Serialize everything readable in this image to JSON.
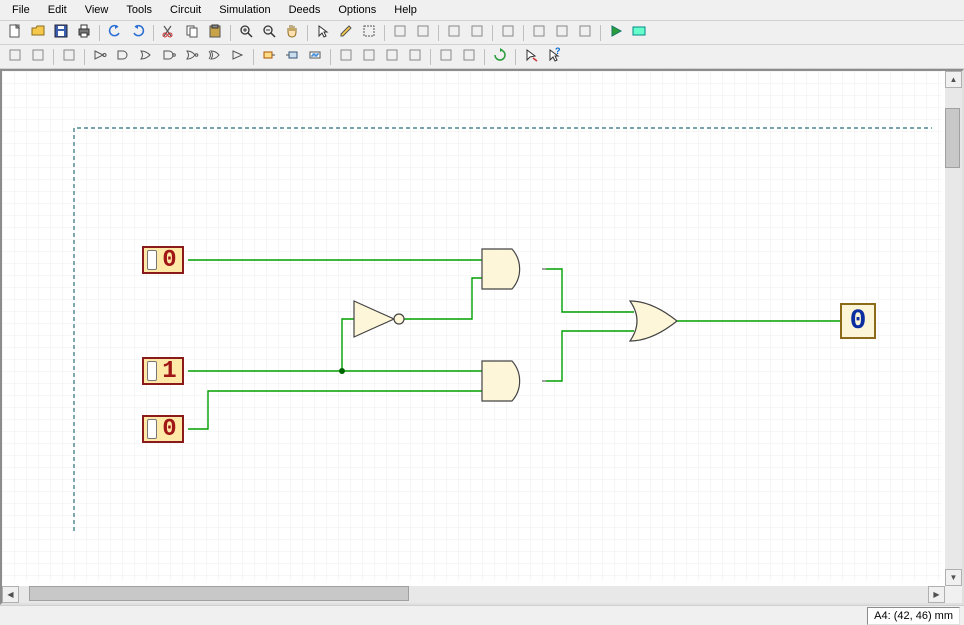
{
  "menu": [
    "File",
    "Edit",
    "View",
    "Tools",
    "Circuit",
    "Simulation",
    "Deeds",
    "Options",
    "Help"
  ],
  "status": {
    "coords": "A4: (42, 46) mm"
  },
  "toolbar1": [
    "new",
    "open",
    "save",
    "print",
    "sep",
    "undo",
    "redo",
    "sep",
    "cut",
    "copy",
    "paste",
    "sep",
    "zoom-in",
    "zoom-out",
    "pan",
    "sep",
    "pointer",
    "pencil",
    "select-rect",
    "sep",
    "component1",
    "component2",
    "sep",
    "mode1",
    "mode2",
    "sep",
    "grid",
    "sep",
    "wave1",
    "wave2",
    "wave3",
    "sep",
    "play",
    "animate"
  ],
  "toolbar2": [
    "ic1",
    "ic2",
    "sep",
    "probe",
    "sep",
    "not",
    "and",
    "or",
    "nand",
    "nor",
    "xor",
    "buffer",
    "sep",
    "input",
    "output",
    "clock",
    "sep",
    "display",
    "led",
    "segment",
    "bus",
    "sep",
    "mux",
    "demux",
    "sep",
    "refresh",
    "sep",
    "cursor",
    "help"
  ],
  "circuit": {
    "inputs": [
      {
        "id": "in0",
        "value": "0"
      },
      {
        "id": "in1",
        "value": "1"
      },
      {
        "id": "in2",
        "value": "0"
      }
    ],
    "output": {
      "id": "out0",
      "value": "0"
    },
    "gates": [
      {
        "id": "g-not",
        "type": "not"
      },
      {
        "id": "g-and1",
        "type": "and"
      },
      {
        "id": "g-and2",
        "type": "and"
      },
      {
        "id": "g-or",
        "type": "or"
      }
    ]
  }
}
